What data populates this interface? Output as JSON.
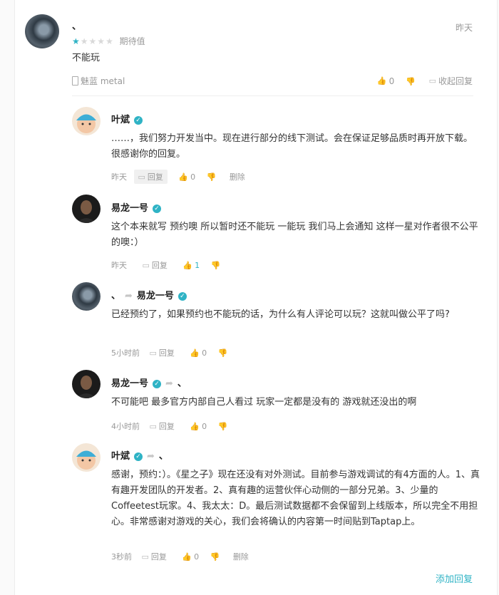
{
  "review": {
    "user_name": "、",
    "rating": 1,
    "rating_max": 5,
    "rating_label": "期待值",
    "date": "昨天",
    "content": "不能玩",
    "device": "魅蓝 metal",
    "up_count": "0",
    "collapse_label": "收起回复"
  },
  "replies": [
    {
      "user": "叶斌",
      "verified": true,
      "to": "",
      "content": "……，我们努力开发当中。现在进行部分的线下测试。会在保证足够品质时再开放下载。很感谢你的回复。",
      "time": "昨天",
      "reply_label": "回复",
      "up": "0",
      "delete_label": "删除"
    },
    {
      "user": "易龙一号",
      "verified": true,
      "to": "",
      "content": "这个本来就写 预约噢 所以暂时还不能玩 一能玩 我们马上会通知 这样一星对作者很不公平的噢：）",
      "time": "昨天",
      "reply_label": "回复",
      "up": "1"
    },
    {
      "user": "、",
      "verified": false,
      "to": "易龙一号",
      "to_verified": true,
      "content": "已经预约了，如果预约也不能玩的话，为什么有人评论可以玩？这就叫做公平了吗?",
      "time": "5小时前",
      "reply_label": "回复",
      "up": "0"
    },
    {
      "user": "易龙一号",
      "verified": true,
      "to": "、",
      "content": "不可能吧 最多官方内部自己人看过 玩家一定都是没有的 游戏就还没出的啊",
      "time": "4小时前",
      "reply_label": "回复",
      "up": "0"
    },
    {
      "user": "叶斌",
      "verified": true,
      "to": "、",
      "content": "感谢，预约：）。《星之子》现在还没有对外测试。目前参与游戏调试的有4方面的人。1、真有趣开发团队的开发者。2、真有趣的运营伙伴心动侧的一部分兄弟。3、少量的Coffeetest玩家。4、我太太：D。最后测试数据都不会保留到上线版本，所以完全不用担心。非常感谢对游戏的关心，我们会将确认的内容第一时间贴到Taptap上。",
      "time": "3秒前",
      "reply_label": "回复",
      "up": "0",
      "delete_label": "删除"
    }
  ],
  "add_reply_label": "添加回复",
  "colors": {
    "accent": "#2fb3c5",
    "muted": "#999999"
  }
}
